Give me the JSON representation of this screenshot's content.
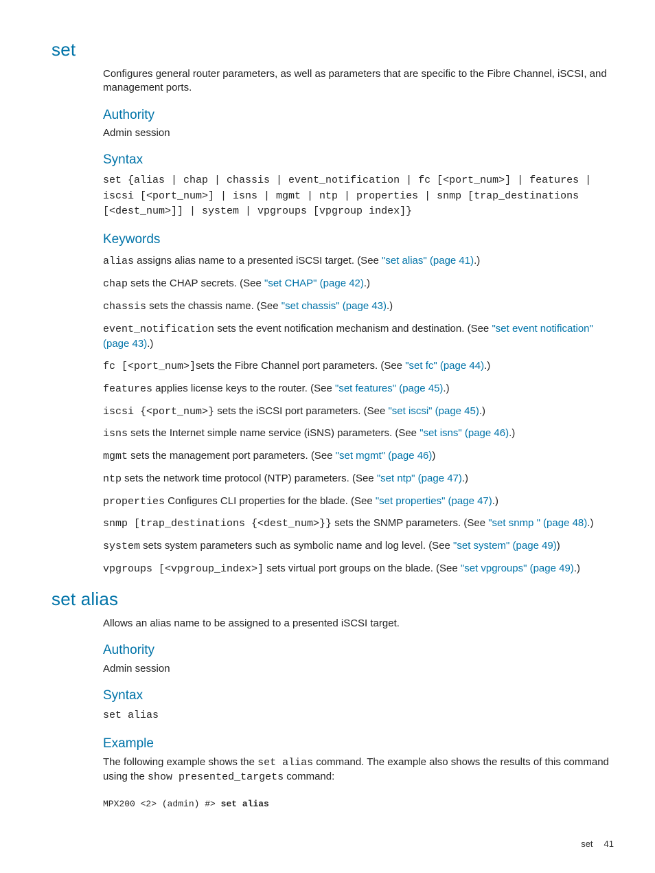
{
  "set": {
    "title": "set",
    "description": "Configures general router parameters, as well as parameters that are specific to the Fibre Channel, iSCSI, and management ports.",
    "authority": {
      "heading": "Authority",
      "text": "Admin session"
    },
    "syntax": {
      "heading": "Syntax",
      "code": "set {alias | chap | chassis | event_notification | fc [<port_num>] | features | iscsi [<port_num>] | isns | mgmt | ntp | properties | snmp [trap_destinations [<dest_num>]] | system | vpgroups [vpgroup index]}"
    },
    "keywords": {
      "heading": "Keywords",
      "items": [
        {
          "kw": "alias",
          "desc_before": " assigns alias name to a presented iSCSI target. (See ",
          "link": "\"set alias\" (page 41)",
          "desc_after": ".)"
        },
        {
          "kw": "chap",
          "desc_before": " sets the CHAP secrets. (See ",
          "link": "\"set CHAP\" (page 42)",
          "desc_after": ".)"
        },
        {
          "kw": "chassis",
          "desc_before": " sets the chassis name. (See ",
          "link": "\"set chassis\" (page 43)",
          "desc_after": ".)"
        },
        {
          "kw": "event_notification",
          "desc_before": " sets the event notification mechanism and destination. (See ",
          "link": "\"set event notification\" (page 43)",
          "desc_after": ".)"
        },
        {
          "kw": "fc [<port_num>]",
          "desc_before": "sets the Fibre Channel port parameters. (See ",
          "link": "\"set fc\" (page 44)",
          "desc_after": ".)"
        },
        {
          "kw": "features",
          "desc_before": " applies license keys to the router. (See ",
          "link": "\"set features\" (page 45)",
          "desc_after": ".)"
        },
        {
          "kw": "iscsi {<port_num>}",
          "desc_before": " sets the iSCSI port parameters. (See ",
          "link": "\"set iscsi\" (page 45)",
          "desc_after": ".)"
        },
        {
          "kw": "isns",
          "desc_before": " sets the Internet simple name service (iSNS) parameters. (See ",
          "link": "\"set isns\" (page 46)",
          "desc_after": ".)"
        },
        {
          "kw": "mgmt",
          "desc_before": " sets the management port parameters. (See ",
          "link": "\"set mgmt\" (page 46)",
          "desc_after": ")"
        },
        {
          "kw": "ntp",
          "desc_before": " sets the network time protocol (NTP) parameters. (See ",
          "link": "\"set ntp\" (page 47)",
          "desc_after": ".)"
        },
        {
          "kw": "properties",
          "desc_before": " Configures CLI properties for the blade. (See ",
          "link": "\"set properties\" (page 47)",
          "desc_after": ".)"
        },
        {
          "kw": "snmp [trap_destinations {<dest_num>}}",
          "desc_before": " sets the SNMP parameters. (See ",
          "link": "\"set snmp \" (page 48)",
          "desc_after": ".)"
        },
        {
          "kw": "system",
          "desc_before": " sets system parameters such as symbolic name and log level. (See ",
          "link": "\"set system\" (page 49)",
          "desc_after": ")"
        },
        {
          "kw": "vpgroups [<vpgroup_index>]",
          "desc_before": " sets virtual port groups on the blade. (See ",
          "link": "\"set vpgroups\" (page 49)",
          "desc_after": ".)"
        }
      ]
    }
  },
  "set_alias": {
    "title": "set alias",
    "description": "Allows an alias name to be assigned to a presented iSCSI target.",
    "authority": {
      "heading": "Authority",
      "text": "Admin session"
    },
    "syntax": {
      "heading": "Syntax",
      "code": "set alias"
    },
    "example": {
      "heading": "Example",
      "intro_before": "The following example shows the ",
      "intro_code1": "set alias",
      "intro_mid": " command. The example also shows the results of this command using the ",
      "intro_code2": "show presented_targets",
      "intro_after": " command:",
      "prompt": "MPX200 <2> (admin) #> ",
      "cmd": "set alias"
    }
  },
  "footer": {
    "label": "set",
    "page": "41"
  }
}
